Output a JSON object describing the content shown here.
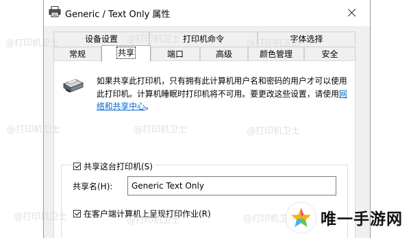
{
  "window": {
    "title": "Generic / Text Only 属性",
    "close_glyph": "close-icon"
  },
  "tabs_row1": [
    {
      "label": "设备设置"
    },
    {
      "label": "打印机命令"
    },
    {
      "label": "字体选择"
    }
  ],
  "tabs_row2": [
    {
      "label": "常规"
    },
    {
      "label": "共享",
      "active": true
    },
    {
      "label": "端口"
    },
    {
      "label": "高级"
    },
    {
      "label": "颜色管理"
    },
    {
      "label": "安全"
    }
  ],
  "sharing": {
    "description_part1": "如果共享此打印机，只有拥有此计算机用户名和密码的用户才可以使用此打印机。计算机睡眠时打印机将不可用。要更改这些设置，请使用",
    "link_text": "网络和共享中心",
    "description_end": "。",
    "share_checkbox_label": "共享这台打印机(S)",
    "share_checked": true,
    "share_name_label": "共享名(H):",
    "share_name_value": "Generic  Text Only",
    "render_jobs_label": "在客户端计算机上呈现打印作业(R)",
    "render_jobs_checked": true
  },
  "watermark": "@打印机卫士",
  "brand_overlay": "唯一手游网",
  "colors": {
    "link": "#0066cc",
    "dialog_bg": "#f0f0f0",
    "watermark": "#dcdcdc"
  }
}
